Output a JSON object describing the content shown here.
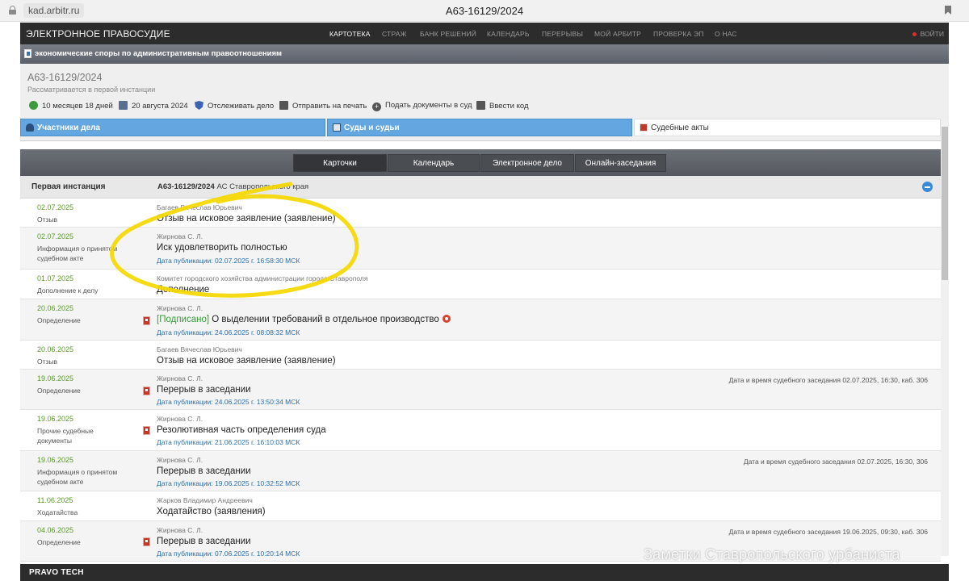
{
  "browser": {
    "url": "kad.arbitr.ru",
    "title": "А63-16129/2024"
  },
  "topnav": {
    "brand": "ЭЛЕКТРОННОЕ ПРАВОСУДИЕ",
    "items": [
      "КАРТОТЕКА",
      "СТРАЖ",
      "БАНК РЕШЕНИЙ",
      "КАЛЕНДАРЬ",
      "ПЕРЕРЫВЫ",
      "МОЙ АРБИТР",
      "ПРОВЕРКА ЭП",
      "О НАС"
    ],
    "active": "КАРТОТЕКА",
    "login": "ВОЙТИ"
  },
  "category": "экономические споры по административным правоотношениям",
  "case": {
    "number": "А63-16129/2024",
    "status": "Рассматривается в первой инстанции",
    "actions": {
      "duration": "10 месяцев 18 дней",
      "date": "20 августа 2024",
      "track": "Отслеживать дело",
      "print": "Отправить на печать",
      "submit": "Подать документы в суд",
      "code": "Ввести код"
    }
  },
  "section_tabs": {
    "participants": "Участники дела",
    "courts": "Суды и судьи",
    "acts": "Судебные акты"
  },
  "subtabs": [
    "Карточки",
    "Календарь",
    "Электронное дело",
    "Онлайн-заседания"
  ],
  "grid": {
    "instance": "Первая инстанция",
    "case_number": "А63-16129/2024",
    "court": "АС Ставропольского края"
  },
  "rows": [
    {
      "date": "02.07.2025",
      "type": "Отзыв",
      "author": "Багаев Вячеслав Юрьевич",
      "title": "Отзыв на исковое заявление (заявление)",
      "pub": "",
      "hearing": "",
      "pdf": false,
      "signed": false
    },
    {
      "date": "02.07.2025",
      "type": "Информация о принятом судебном акте",
      "author": "Жирнова С. Л.",
      "title": "Иск удовлетворить полностью",
      "pub": "Дата публикации: 02.07.2025 г. 16:58:30 МСК",
      "hearing": "",
      "pdf": false,
      "signed": false
    },
    {
      "date": "01.07.2025",
      "type": "Дополнение к делу",
      "author": "Комитет городского хозяйства администрации города Ставрополя",
      "title": "Дополнение",
      "pub": "",
      "hearing": "",
      "pdf": false,
      "signed": false
    },
    {
      "date": "20.06.2025",
      "type": "Определение",
      "author": "Жирнова С. Л.",
      "signed_label": "[Подписано]",
      "title": "О выделении требований в отдельное производство",
      "pub": "Дата публикации: 24.06.2025 г. 08:08:32 МСК",
      "hearing": "",
      "pdf": true,
      "signed": true
    },
    {
      "date": "20.06.2025",
      "type": "Отзыв",
      "author": "Багаев Вячеслав Юрьевич",
      "title": "Отзыв на исковое заявление (заявление)",
      "pub": "",
      "hearing": "",
      "pdf": false,
      "signed": false
    },
    {
      "date": "19.06.2025",
      "type": "Определение",
      "author": "Жирнова С. Л.",
      "title": "Перерыв в заседании",
      "pub": "Дата публикации: 24.06.2025 г. 13:50:34 МСК",
      "hearing": "Дата и время судебного заседания 02.07.2025, 16:30, каб. 306",
      "pdf": true,
      "signed": false
    },
    {
      "date": "19.06.2025",
      "type": "Прочие судебные документы",
      "author": "Жирнова С. Л.",
      "title": "Резолютивная часть определения суда",
      "pub": "Дата публикации: 21.06.2025 г. 16:10:03 МСК",
      "hearing": "",
      "pdf": true,
      "signed": false
    },
    {
      "date": "19.06.2025",
      "type": "Информация о принятом судебном акте",
      "author": "Жирнова С. Л.",
      "title": "Перерыв в заседании",
      "pub": "Дата публикации: 19.06.2025 г. 10:32:52 МСК",
      "hearing": "Дата и время судебного заседания 02.07.2025, 16:30, 306",
      "pdf": false,
      "signed": false
    },
    {
      "date": "11.06.2025",
      "type": "Ходатайства",
      "author": "Жарков Владимир Андреевич",
      "title": "Ходатайство (заявления)",
      "pub": "",
      "hearing": "",
      "pdf": false,
      "signed": false
    },
    {
      "date": "04.06.2025",
      "type": "Определение",
      "author": "Жирнова С. Л.",
      "title": "Перерыв в заседании",
      "pub": "Дата публикации: 07.06.2025 г. 10:20:14 МСК",
      "hearing": "Дата и время судебного заседания 19.06.2025, 09:30, каб. 306",
      "pdf": true,
      "signed": false
    }
  ],
  "footer": {
    "logo": "PRAVO TECH"
  },
  "watermark": "Заметки Ставропольского урбаниста",
  "colors": {
    "highlight_circle": "#f5d800",
    "date_green": "#5a9a2a",
    "link_blue": "#2a6fb0",
    "tab_blue": "#63a6e0"
  }
}
